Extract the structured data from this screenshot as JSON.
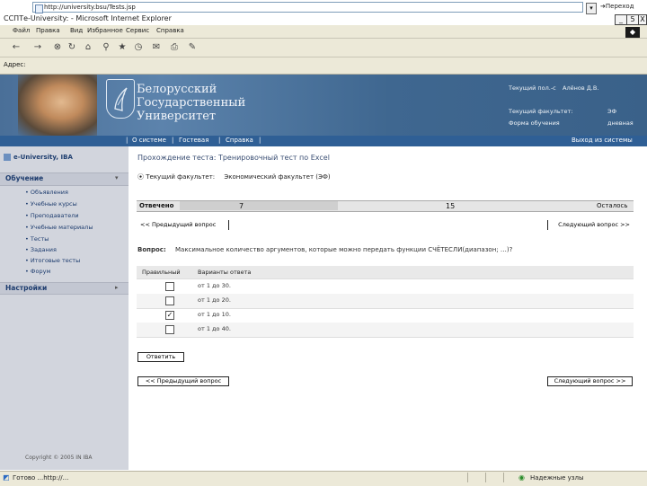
{
  "window": {
    "title": "ССПТе-University: - Microsoft Internet Explorer",
    "controls": [
      "_",
      "5",
      "X"
    ]
  },
  "menu": [
    "Файл",
    "Правка",
    "Вид",
    "Избранное",
    "Сервис",
    "Справка"
  ],
  "toolbar_icons": [
    "back-icon",
    "forward-icon",
    "stop-icon",
    "refresh-icon",
    "home-icon",
    "search-icon",
    "favorites-icon",
    "history-icon",
    "mail-icon",
    "print-icon",
    "edit-icon"
  ],
  "address": {
    "label": "Адрес:",
    "value": "http://university.bsu/Tests.jsp",
    "go_label": "Переход"
  },
  "header": {
    "university": [
      "Белорусский",
      "Государственный",
      "Университет"
    ],
    "info": [
      {
        "label": "Текущий пол.-с",
        "value": "Алёнов Д.В."
      },
      {
        "label": "Текущий факультет:",
        "value": "ЭФ"
      },
      {
        "label": "Форма обучения",
        "value": "дневная"
      }
    ]
  },
  "nav": {
    "links": [
      "О системе",
      "Гостевая",
      "Справка"
    ],
    "logout": "Выход из системы"
  },
  "sidebar": {
    "logo": "e-University, IBA",
    "section1": "Обучение",
    "items": [
      "Объявления",
      "Учебные курсы",
      "Преподаватели",
      "Учебные материалы",
      "Тесты",
      "Задания",
      "Итоговые тесты",
      "Форум"
    ],
    "section2": "Настройки",
    "copyright": "Copyright © 2005 IN IBA"
  },
  "main": {
    "title": "Прохождение теста: Тренировочный тест по Excel",
    "faculty_label": "Текущий факультет:",
    "faculty_value": "Экономический факультет (ЭФ)",
    "answered_label": "Отвечено",
    "answered_count": "7",
    "remaining_count": "15",
    "remaining_label": "Осталось",
    "answered_fraction": 0.318,
    "prev_button": "<< Предыдущий вопрос",
    "next_button": "Следующий вопрос >>",
    "question_label": "Вопрос:",
    "question_text": "Максимальное количество аргументов, которые можно передать функции СЧЁТЕСЛИ(диапазон; …)?",
    "table_headers": [
      "Правильный",
      "Варианты ответа"
    ],
    "answers": [
      {
        "text": "от 1 до 30.",
        "checked": false
      },
      {
        "text": "от 1 до 20.",
        "checked": false
      },
      {
        "text": "от 1 до 10.",
        "checked": true
      },
      {
        "text": "от 1 до 40.",
        "checked": false
      }
    ],
    "answer_button": "Ответить"
  },
  "status": {
    "text": "Готово ...http://...",
    "zone": "Надежные узлы"
  }
}
